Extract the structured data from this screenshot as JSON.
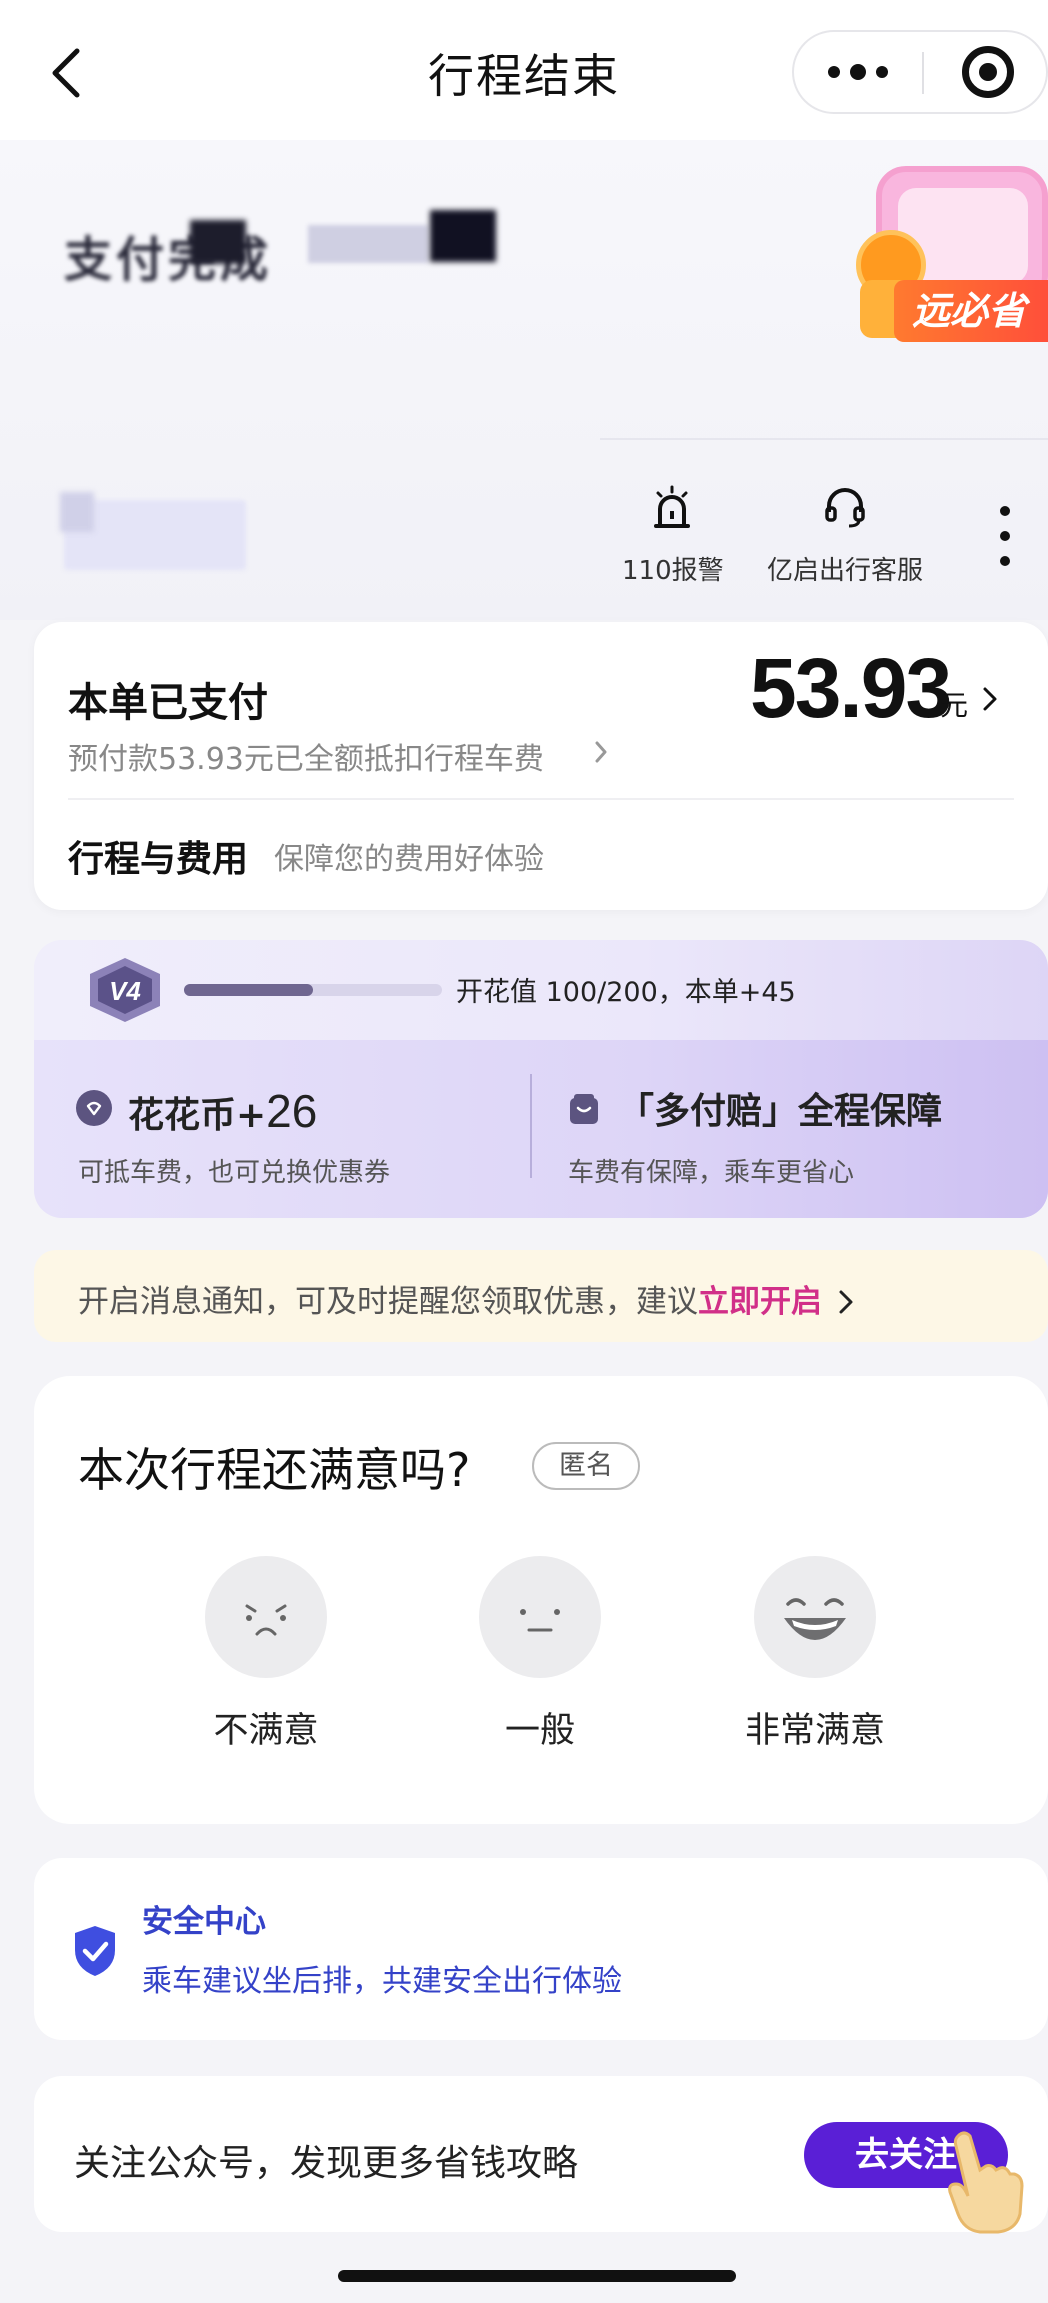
{
  "header": {
    "title": "行程结束"
  },
  "status": {
    "paid_title": "支付完成",
    "promo_label": "远必省"
  },
  "tools": {
    "alarm_label": "110报警",
    "service_label": "亿启出行客服"
  },
  "payment": {
    "title": "本单已支付",
    "amount": "53.93",
    "currency": "元",
    "prepay_note": "预付款53.93元已全额抵扣行程车费",
    "trip_fee_label": "行程与费用",
    "trip_fee_sub": "保障您的费用好体验"
  },
  "member": {
    "level": "V4",
    "progress": 0.5,
    "value_text": "开花值 100/200，本单+45",
    "coin_label": "花花币+",
    "coin_num": "26",
    "coin_sub": "可抵车费，也可兑换优惠券",
    "guard_title": "「多付赔」全程保障",
    "guard_sub": "车费有保障，乘车更省心"
  },
  "notice": {
    "text": "开启消息通知，可及时提醒您领取优惠，建议",
    "link": "立即开启"
  },
  "rating": {
    "title": "本次行程还满意吗?",
    "anonymous": "匿名",
    "options": [
      "不满意",
      "一般",
      "非常满意"
    ]
  },
  "safety": {
    "title": "安全中心",
    "subtitle": "乘车建议坐后排，共建安全出行体验"
  },
  "follow": {
    "text": "关注公众号，发现更多省钱攻略",
    "button": "去关注"
  },
  "colors": {
    "accent_purple": "#5a1fd6",
    "link_pink": "#d12f88",
    "safety_blue": "#3442c8"
  }
}
